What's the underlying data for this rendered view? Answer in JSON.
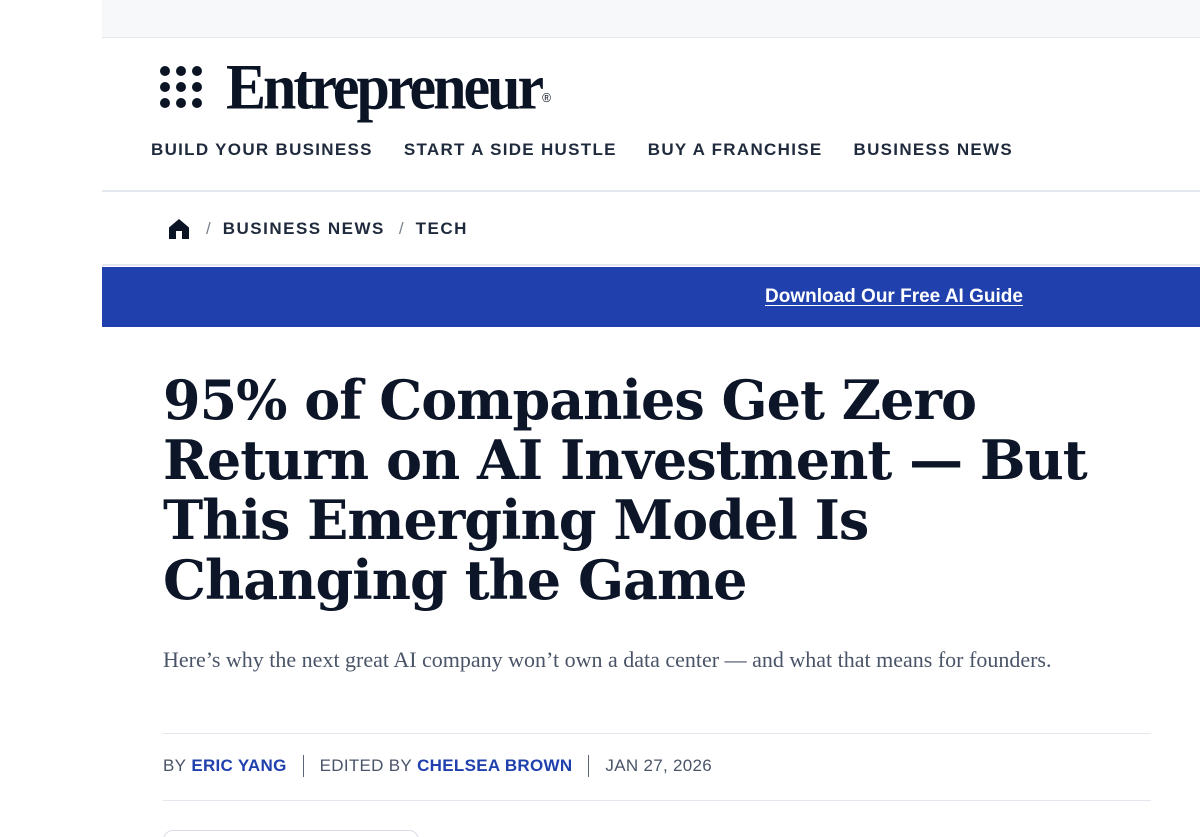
{
  "brand": {
    "name": "Entrepreneur",
    "registered_mark": "®"
  },
  "main_nav": [
    {
      "label": "BUILD YOUR BUSINESS"
    },
    {
      "label": "START A SIDE HUSTLE"
    },
    {
      "label": "BUY A FRANCHISE"
    },
    {
      "label": "BUSINESS NEWS"
    }
  ],
  "breadcrumb": {
    "home_icon": "home-icon",
    "separator": "/",
    "items": [
      {
        "label": "BUSINESS NEWS"
      },
      {
        "label": "TECH"
      }
    ]
  },
  "promo": {
    "link_label": "Download Our Free AI Guide",
    "background": "#1f40ad"
  },
  "article": {
    "headline": "95% of Companies Get Zero Return on AI Investment — But This Emerging Model Is Changing the Game",
    "dek": "Here’s why the next great AI company won’t own a data center — and what that means for founders.",
    "byline": {
      "by_label": "BY",
      "author": "ERIC YANG",
      "edited_by_label": "EDITED BY",
      "editor": "CHELSEA BROWN",
      "date": "JAN 27, 2026"
    }
  },
  "colors": {
    "accent": "#1f40ad",
    "text_dark": "#0d1628",
    "text_muted": "#4a5468"
  }
}
